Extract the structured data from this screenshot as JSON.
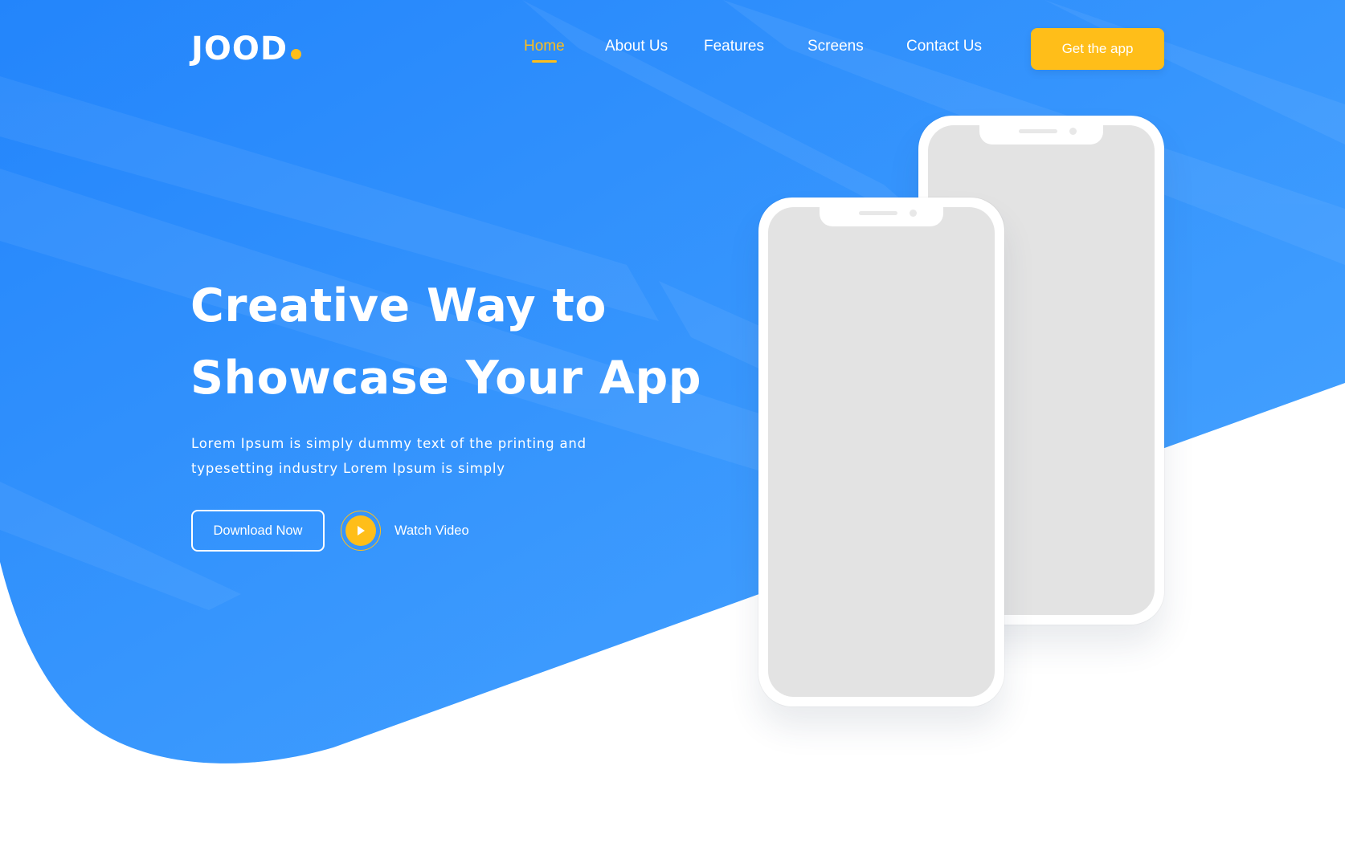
{
  "brand": {
    "logo": "JOOD",
    "accent_color": "#ffbe19",
    "primary_color": "#2f8efc"
  },
  "nav": {
    "items": [
      {
        "label": "Home",
        "active": true
      },
      {
        "label": "About Us",
        "active": false
      },
      {
        "label": "Features",
        "active": false
      },
      {
        "label": "Screens",
        "active": false
      },
      {
        "label": "Contact Us",
        "active": false
      }
    ],
    "cta_label": "Get the app"
  },
  "hero": {
    "headline_line1": "Creative Way to",
    "headline_line2": "Showcase Your App",
    "description_line1": "Lorem Ipsum is simply dummy text of the printing and",
    "description_line2": "typesetting industry Lorem Ipsum is simply",
    "download_label": "Download Now",
    "watch_label": "Watch Video"
  },
  "icons": {
    "play": "play-icon"
  }
}
